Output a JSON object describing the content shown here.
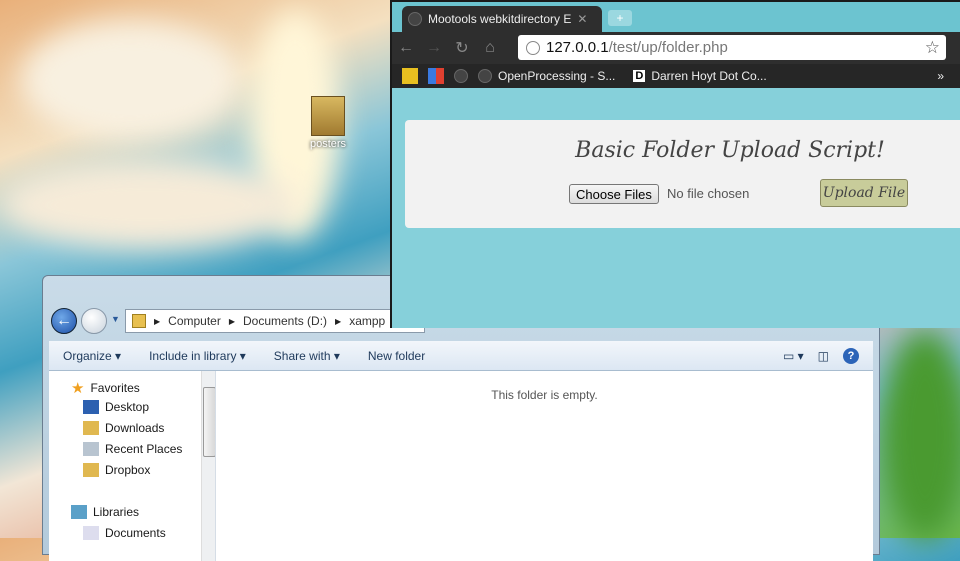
{
  "desktop": {
    "icon_label": "posters"
  },
  "browser": {
    "tab_title": "Mootools webkitdirectory E",
    "new_tab": "+",
    "url_host": "127.0.0.1",
    "url_path": "/test/up/folder.php",
    "bookmarks": [
      "OpenProcessing - S...",
      "Darren Hoyt Dot Co..."
    ],
    "bookmarks_overflow": "»",
    "page": {
      "title": "Basic Folder Upload Script!",
      "choose_files": "Choose Files",
      "no_file": "No file chosen",
      "upload": "Upload File"
    }
  },
  "explorer": {
    "breadcrumb": [
      "Computer",
      "Documents (D:)",
      "xampp"
    ],
    "commands": [
      "Organize",
      "Include in library",
      "Share with",
      "New folder"
    ],
    "nav": {
      "favorites": "Favorites",
      "items": [
        "Desktop",
        "Downloads",
        "Recent Places",
        "Dropbox"
      ],
      "libraries": "Libraries",
      "lib_items": [
        "Documents"
      ]
    },
    "empty_message": "This folder is empty."
  }
}
